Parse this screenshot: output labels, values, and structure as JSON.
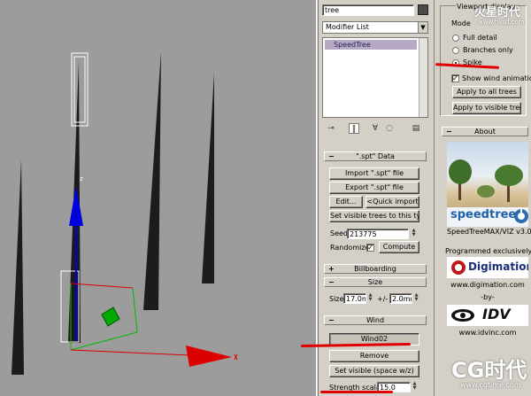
{
  "viewport": {
    "gizmo_label": "z"
  },
  "modify": {
    "object_name": "tree",
    "modifier_list_label": "Modifier List",
    "stack_item": "SpeedTree"
  },
  "spt_data": {
    "title": "\".spt\" Data",
    "import_label": "Import \".spt\" file",
    "export_label": "Export \".spt\" file",
    "edit_label": "Edit...",
    "quick_import_label": "<Quick import",
    "set_visible_label": "Set visible trees to this type",
    "seed_label": "Seed",
    "seed_value": "213775",
    "randomize_label": "Randomize",
    "compute_label": "Compute"
  },
  "billboarding": {
    "title": "Billboarding"
  },
  "size": {
    "title": "Size",
    "size_label": "Size",
    "size_value": "17.0m",
    "variance_label": "+/-",
    "variance_value": "2.0mr"
  },
  "wind": {
    "title": "Wind",
    "wind_button": "Wind02",
    "remove_label": "Remove",
    "set_visible_label": "Set visible (space w/z)",
    "strength_label": "Strength scalar",
    "strength_value": "15.0"
  },
  "viewport_display": {
    "title": "Viewport display",
    "mode_label": "Mode",
    "options": [
      "Full detail",
      "Branches only",
      "Spike"
    ],
    "selected": "Spike",
    "wind_anim_label": "Show wind animation",
    "apply_all_label": "Apply to all trees",
    "apply_visible_label": "Apply to visible trees"
  },
  "about": {
    "title": "About",
    "logo_text": "speedtree",
    "version": "SpeedTreeMAX/VIZ v3.0",
    "programmed_label": "Programmed exclusively for",
    "digimation_logo": "Digimation",
    "digimation_url": "www.digimation.com",
    "by_label": "-by-",
    "idv_logo": "IDV",
    "idv_url": "www.idvinc.com"
  },
  "watermarks": {
    "top_brand": "火星时代",
    "top_url": "www.hxsd.com",
    "bottom_brand": "CG时代",
    "bottom_url": "www.cgtime.com"
  },
  "colors": {
    "annotation_red": "#e00000",
    "stack_select": "#b5a9c4",
    "viewport_bg": "#9c9c9c"
  }
}
